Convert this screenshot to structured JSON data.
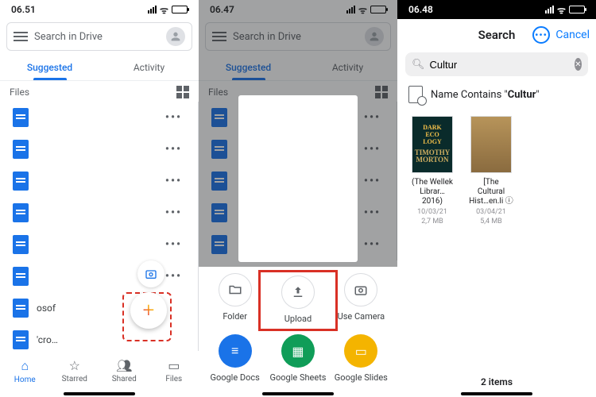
{
  "panel1": {
    "time": "06.51",
    "search_placeholder": "Search in Drive",
    "tabs": {
      "suggested": "Suggested",
      "activity": "Activity"
    },
    "section_label": "Files",
    "rows": [
      "",
      "",
      "",
      "",
      "",
      "",
      "osof",
      "'cro…"
    ],
    "bottom": {
      "home": "Home",
      "starred": "Starred",
      "shared": "Shared",
      "files": "Files"
    }
  },
  "panel2": {
    "time": "06.47",
    "search_placeholder": "Search in Drive",
    "tabs": {
      "suggested": "Suggested",
      "activity": "Activity"
    },
    "section_label": "Files",
    "actions": {
      "folder": "Folder",
      "upload": "Upload",
      "camera": "Use Camera",
      "docs": "Google Docs",
      "sheets": "Google Sheets",
      "slides": "Google Slides"
    }
  },
  "panel3": {
    "time": "06.48",
    "title": "Search",
    "cancel": "Cancel",
    "query": "Cultur",
    "contains_prefix": "Name Contains \"",
    "contains_term": "Cultur",
    "contains_suffix": "\"",
    "results": [
      {
        "cover_line1": "DARK",
        "cover_line2": "ECO",
        "cover_line3": "LOGY",
        "cover_author": "TIMOTHY MORTON",
        "title": "(The Wellek Librar…2016)",
        "date": "10/03/21",
        "size": "2,7 MB"
      },
      {
        "cover_note": "",
        "title": "[The Cultural Hist…en.li ⓘ",
        "date": "03/04/21",
        "size": "5,4 MB"
      }
    ],
    "footer": "2 items"
  }
}
